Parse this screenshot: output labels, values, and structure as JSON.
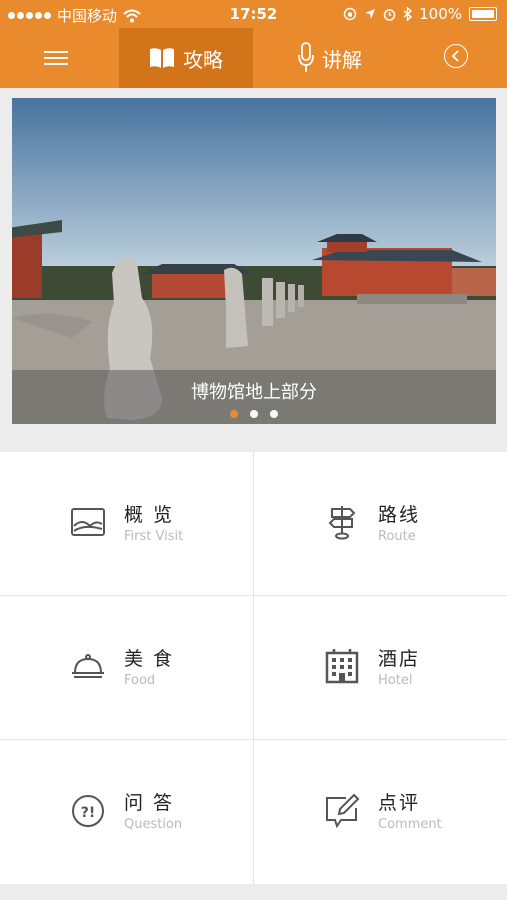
{
  "status": {
    "carrier": "中国移动",
    "time": "17:52",
    "battery": "100%"
  },
  "nav": {
    "tabs": [
      {
        "label": "攻略"
      },
      {
        "label": "讲解"
      }
    ]
  },
  "banner": {
    "caption": "博物馆地上部分",
    "pages": 3,
    "active_page": 1
  },
  "grid": [
    {
      "title": "概 览",
      "subtitle": "First Visit",
      "icon": "image-icon"
    },
    {
      "title": "路线",
      "subtitle": "Route",
      "icon": "signpost-icon"
    },
    {
      "title": "美 食",
      "subtitle": "Food",
      "icon": "cloche-icon"
    },
    {
      "title": "酒店",
      "subtitle": "Hotel",
      "icon": "hotel-building-icon"
    },
    {
      "title": "问 答",
      "subtitle": "Question",
      "icon": "question-icon"
    },
    {
      "title": "点评",
      "subtitle": "Comment",
      "icon": "comment-edit-icon"
    }
  ],
  "colors": {
    "accent": "#e98a2d",
    "accent_dark": "#d2741a"
  }
}
